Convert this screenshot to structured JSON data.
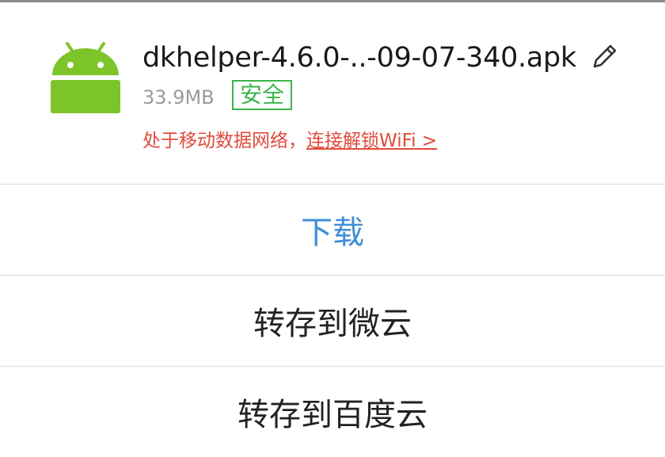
{
  "file": {
    "name": "dkhelper-4.6.0-..-09-07-340.apk",
    "size": "33.9MB",
    "safety_badge": "安全",
    "icon": "android-icon",
    "edit_icon": "pencil-icon"
  },
  "network_notice": {
    "text": "处于移动数据网络，",
    "link": "连接解锁WiFi >"
  },
  "actions": [
    {
      "label": "下载"
    },
    {
      "label": "转存到微云"
    },
    {
      "label": "转存到百度云"
    }
  ],
  "colors": {
    "download_blue": "#3f8fd8",
    "safe_green": "#3cb54a",
    "warning_red": "#e04b3c",
    "android_green": "#7cc42a"
  }
}
